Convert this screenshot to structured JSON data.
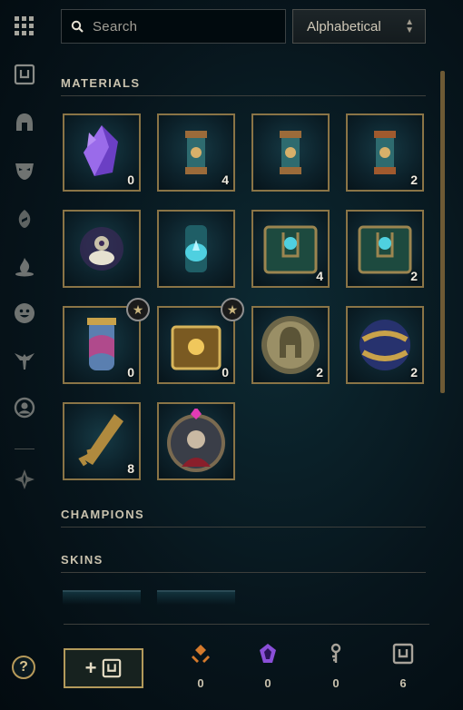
{
  "search": {
    "placeholder": "Search"
  },
  "sort": {
    "selected": "Alphabetical"
  },
  "sidebar": {
    "icons": [
      "grid-icon",
      "chest-icon",
      "helmet-icon",
      "mask-icon",
      "ward-icon",
      "fire-icon",
      "smiley-icon",
      "emblem-icon",
      "profile-icon",
      "loot-icon"
    ],
    "help_label": "?"
  },
  "sections": {
    "materials": "MATERIALS",
    "champions": "CHAMPIONS",
    "skins": "SKINS"
  },
  "materials": [
    {
      "name": "mythic-essence-icon",
      "count": "0"
    },
    {
      "name": "capsule-icon",
      "count": "4"
    },
    {
      "name": "capsule-icon",
      "count": ""
    },
    {
      "name": "capsule-icon",
      "count": "2"
    },
    {
      "name": "glowing-orb-icon",
      "count": ""
    },
    {
      "name": "blue-capsule-icon",
      "count": ""
    },
    {
      "name": "hextech-chest-icon",
      "count": "4"
    },
    {
      "name": "hextech-chest-icon",
      "count": "2"
    },
    {
      "name": "prestige-capsule-icon",
      "count": "0"
    },
    {
      "name": "golden-chest-icon",
      "count": "0"
    },
    {
      "name": "helmet-token-icon",
      "count": "2"
    },
    {
      "name": "orb-icon",
      "count": "2"
    },
    {
      "name": "key-fragment-icon",
      "count": "8"
    },
    {
      "name": "champion-portrait-icon",
      "count": ""
    }
  ],
  "footer": {
    "add_label": "+",
    "currencies": [
      {
        "name": "orange-essence-icon",
        "value": "0",
        "color": "#d57a2c"
      },
      {
        "name": "mythic-essence-icon",
        "value": "0",
        "color": "#8a4fd8"
      },
      {
        "name": "key-icon",
        "value": "0",
        "color": "#a8a39a"
      },
      {
        "name": "chest-icon",
        "value": "6",
        "color": "#a8a39a"
      }
    ]
  }
}
